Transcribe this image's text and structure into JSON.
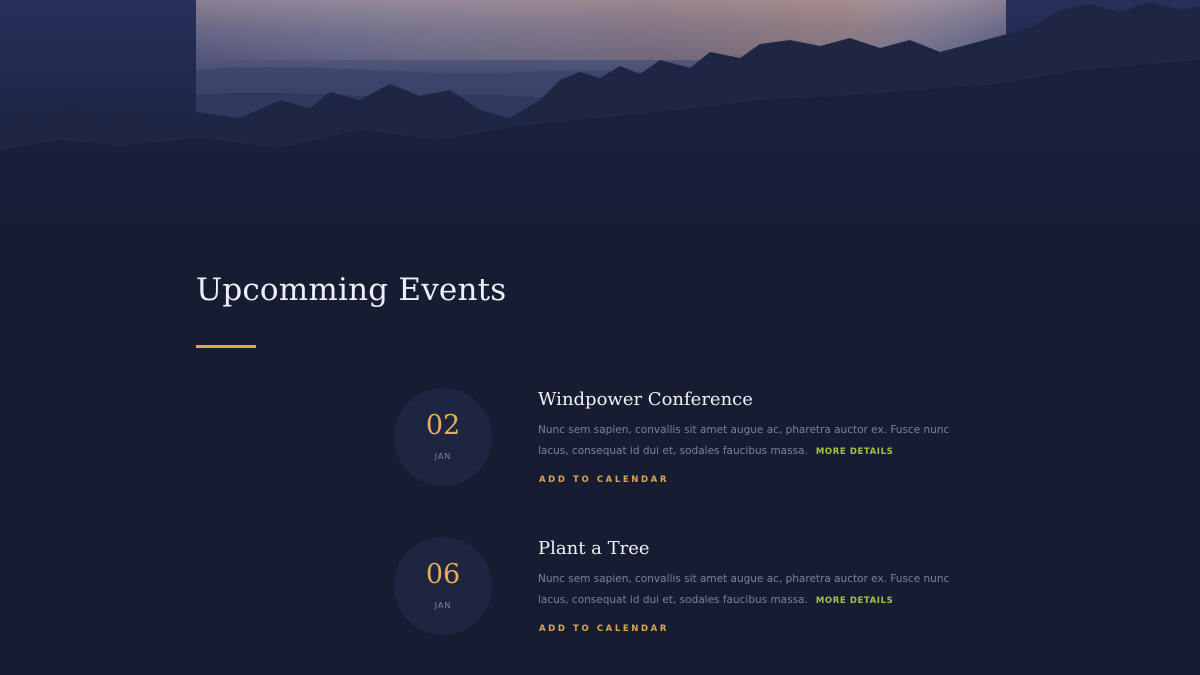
{
  "section": {
    "title": "Upcomming Events"
  },
  "events": [
    {
      "day": "02",
      "month": "JAN",
      "title": "Windpower Conference",
      "description": "Nunc sem sapien, convallis sit amet augue ac, pharetra auctor ex. Fusce nunc lacus, consequat id dui et, sodales faucibus massa.",
      "more_label": "MORE DETAILS",
      "calendar_label": "ADD TO CALENDAR"
    },
    {
      "day": "06",
      "month": "JAN",
      "title": "Plant a Tree",
      "description": "Nunc sem sapien, convallis sit amet augue ac, pharetra auctor ex. Fusce nunc lacus, consequat id dui et, sodales faucibus massa.",
      "more_label": "MORE DETAILS",
      "calendar_label": "ADD TO CALENDAR"
    }
  ],
  "colors": {
    "background": "#161d33",
    "accent": "#e0a54e",
    "link_green": "#a7c24a",
    "date_circle": "#1d2540"
  }
}
